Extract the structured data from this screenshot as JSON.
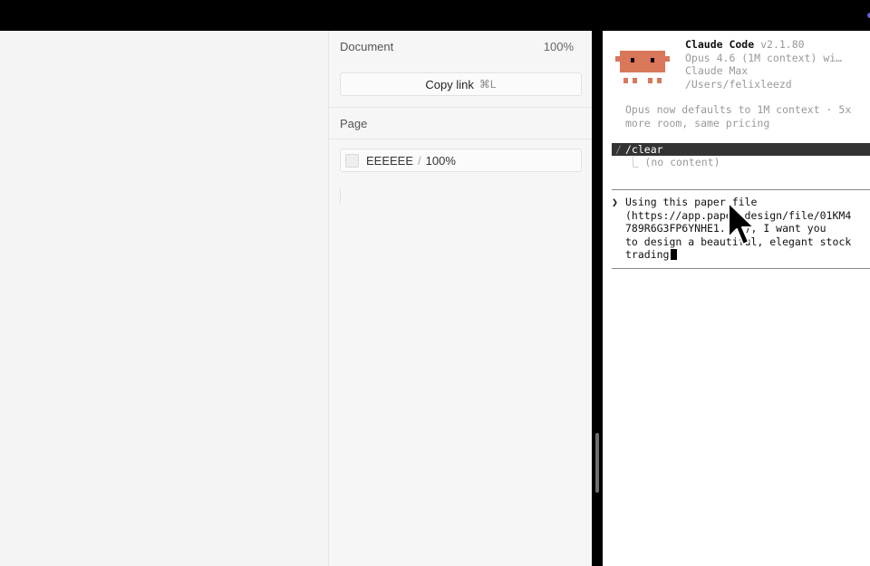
{
  "panel": {
    "document_label": "Document",
    "document_zoom": "100%",
    "copy_link_label": "Copy link",
    "copy_link_shortcut": "⌘L",
    "page_label": "Page",
    "fill_hex": "EEEEEE",
    "fill_opacity": "100%",
    "fill_color": "#EEEEEE"
  },
  "terminal": {
    "app_name": "Claude Code",
    "version": "v2.1.80",
    "model_line": "Opus 4.6 (1M context) wi…",
    "plan_line": "Claude Max",
    "path_line": "/Users/felixleezd",
    "notice_line1": "Opus now defaults to 1M context · 5x",
    "notice_line2": "more room, same pricing",
    "last_command": "/clear",
    "last_command_result": "⎿  (no content)",
    "prompt_symbol": "❯",
    "prompt_text": "Using this paper file\n(https://app.paper.design/file/01KM4\n789R6G3FP6YNHE1...B), I want you\nto design a beautiful, elegant stock\ntrading",
    "mascot_color": "#D9775A"
  },
  "icons": {
    "mouse_cursor": "arrow-pointer-icon",
    "mascot": "claude-mascot-icon"
  }
}
